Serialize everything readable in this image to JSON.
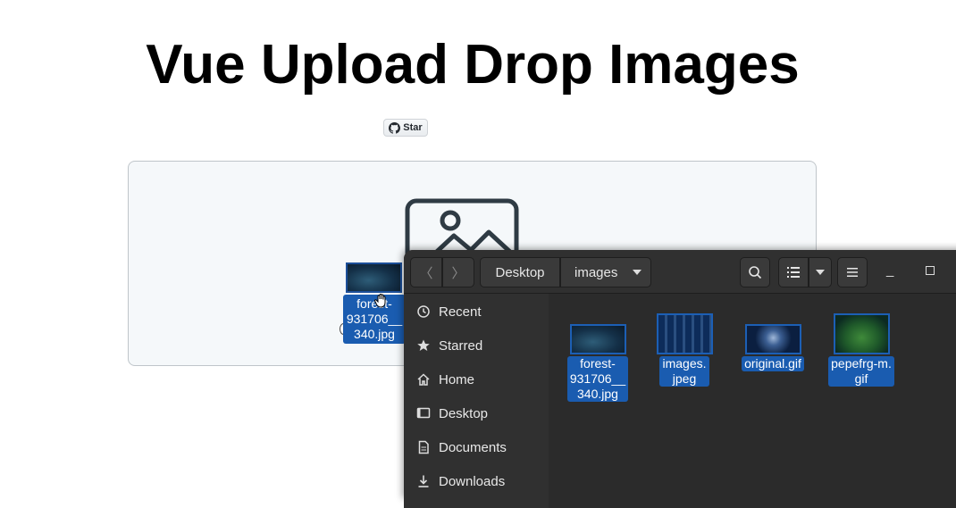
{
  "page": {
    "title": "Vue Upload Drop Images",
    "star_label": "Star"
  },
  "drag": {
    "file_label": "forest-\n931706__\n340.jpg"
  },
  "file_manager": {
    "path": {
      "parent": "Desktop",
      "current": "images"
    },
    "sidebar": [
      {
        "label": "Recent",
        "icon": "clock-icon"
      },
      {
        "label": "Starred",
        "icon": "star-icon"
      },
      {
        "label": "Home",
        "icon": "home-icon"
      },
      {
        "label": "Desktop",
        "icon": "desktop-icon"
      },
      {
        "label": "Documents",
        "icon": "documents-icon"
      },
      {
        "label": "Downloads",
        "icon": "download-icon"
      }
    ],
    "files": [
      {
        "name": "forest-\n931706__\n340.jpg"
      },
      {
        "name": "images.\njpeg"
      },
      {
        "name": "original.gif"
      },
      {
        "name": "pepefrg-m.\ngif"
      }
    ]
  },
  "colors": {
    "selection": "#1a5cb0",
    "fm_bg": "#2b2b2b",
    "drop_zone_bg": "#f5f8fa"
  }
}
